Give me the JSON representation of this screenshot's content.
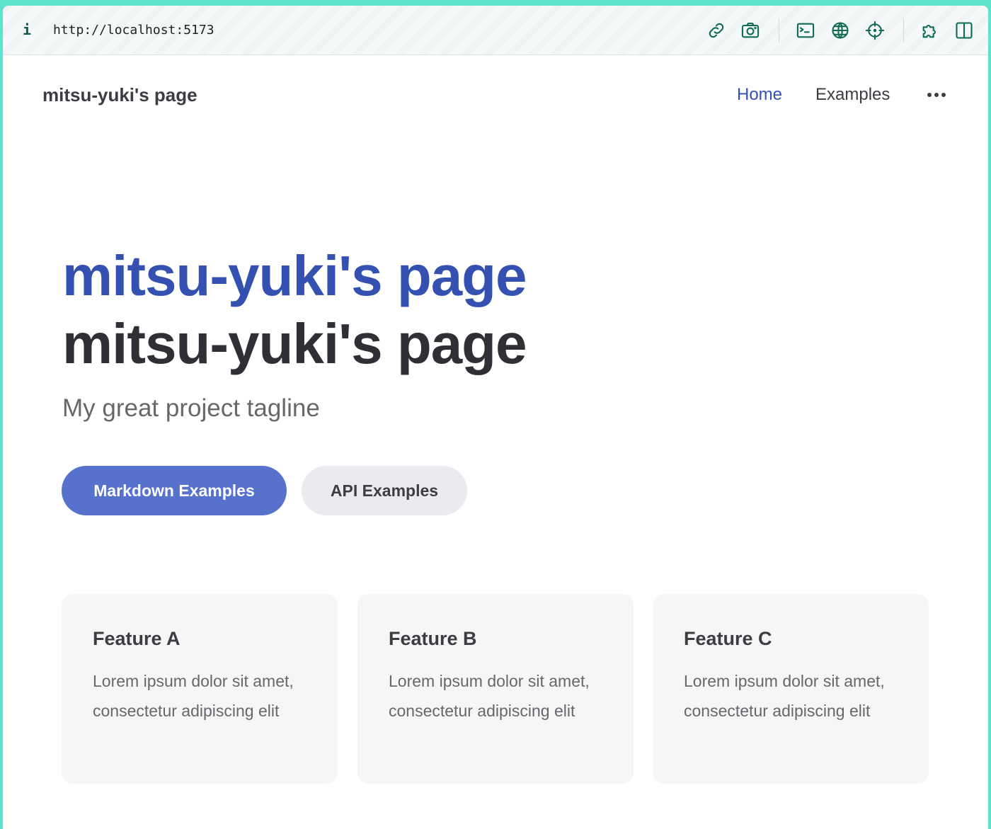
{
  "browser": {
    "info_icon": "i",
    "url": "http://localhost:5173",
    "icons": [
      "link-icon",
      "camera-icon",
      "terminal-icon",
      "globe-icon",
      "crosshair-icon",
      "puzzle-icon",
      "sidebar-icon"
    ]
  },
  "nav": {
    "title": "mitsu-yuki's page",
    "links": [
      "Home",
      "Examples"
    ],
    "more_icon": "more-icon"
  },
  "hero": {
    "name": "mitsu-yuki's page",
    "text": "mitsu-yuki's page",
    "tagline": "My great project tagline",
    "actions": [
      "Markdown Examples",
      "API Examples"
    ]
  },
  "features": [
    {
      "title": "Feature A",
      "details": "Lorem ipsum dolor sit amet, consectetur adipiscing elit"
    },
    {
      "title": "Feature B",
      "details": "Lorem ipsum dolor sit amet, consectetur adipiscing elit"
    },
    {
      "title": "Feature C",
      "details": "Lorem ipsum dolor sit amet, consectetur adipiscing elit"
    }
  ],
  "colors": {
    "brand": "#3451b2",
    "button_brand": "#5672cd",
    "frame_accent": "#5ee3cf",
    "icon": "#0f6b55"
  }
}
